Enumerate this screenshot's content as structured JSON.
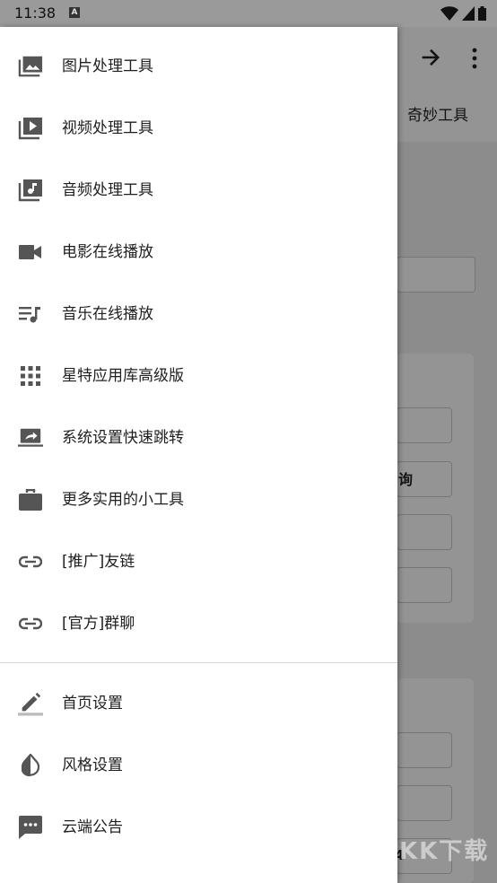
{
  "status_bar": {
    "time": "11:38",
    "notification_badge": "A"
  },
  "background": {
    "tab_label": "奇妙工具",
    "button_text": "询",
    "number_text": "4",
    "watermark": "KK下载"
  },
  "drawer": {
    "primary_items": [
      {
        "label": "图片处理工具",
        "icon": "photo-library-icon"
      },
      {
        "label": "视频处理工具",
        "icon": "video-library-icon"
      },
      {
        "label": "音频处理工具",
        "icon": "library-music-icon"
      },
      {
        "label": "电影在线播放",
        "icon": "videocam-icon"
      },
      {
        "label": "音乐在线播放",
        "icon": "queue-music-icon"
      },
      {
        "label": "星特应用库高级版",
        "icon": "apps-grid-icon"
      },
      {
        "label": "系统设置快速跳转",
        "icon": "screen-share-icon"
      },
      {
        "label": "更多实用的小工具",
        "icon": "briefcase-icon"
      },
      {
        "label": "[推广]友链",
        "icon": "link-icon"
      },
      {
        "label": "[官方]群聊",
        "icon": "link-icon"
      }
    ],
    "secondary_items": [
      {
        "label": "首页设置",
        "icon": "edit-pen-icon"
      },
      {
        "label": "风格设置",
        "icon": "invert-colors-icon"
      },
      {
        "label": "云端公告",
        "icon": "chat-bubble-icon"
      }
    ]
  },
  "colors": {
    "icon": "#555555",
    "text": "#202020",
    "scrim": "#000000"
  }
}
